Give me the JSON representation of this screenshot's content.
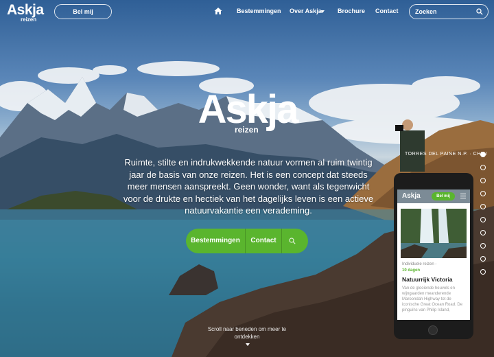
{
  "brand": {
    "name": "Askja",
    "sub": "reizen"
  },
  "nav": {
    "bel_mij": "Bel mij",
    "home_icon": "home-icon",
    "links": [
      "Bestemmingen",
      "Over Askja",
      "Brochure",
      "Contact"
    ],
    "search_placeholder": "Zoeken"
  },
  "hero": {
    "title": "Askja",
    "sub": "reizen",
    "intro": "Ruimte, stilte en indrukwekkende natuur vormen al ruim twintig jaar de basis van onze reizen. Het is een concept dat steeds meer mensen aanspreekt. Geen wonder, want als tegenwicht voor de drukte en hectiek van het dagelijks leven is een actieve natuurvakantie een verademing.",
    "cta": {
      "destinations": "Bestemmingen",
      "contact": "Contact"
    },
    "location": "TORRES DEL PAINE N.P. · CHILI",
    "scroll": "Scroll naar beneden om meer te ontdekken",
    "slides": 10,
    "active_slide": 1
  },
  "phone": {
    "logo": "Askja",
    "bel": "Bel mij",
    "meta_prefix": "Individuele reizen - ",
    "meta_days": "10 dagen",
    "title": "Natuurrijk Victoria",
    "text": "Van de glooiende heuvels en wijngaarden meanderende Maroondah Highway tot de iconische Great Ocean Road. De pinguïns van Philip Island,"
  },
  "colors": {
    "accent": "#5ab52e",
    "phone_header": "#7c8b96"
  }
}
